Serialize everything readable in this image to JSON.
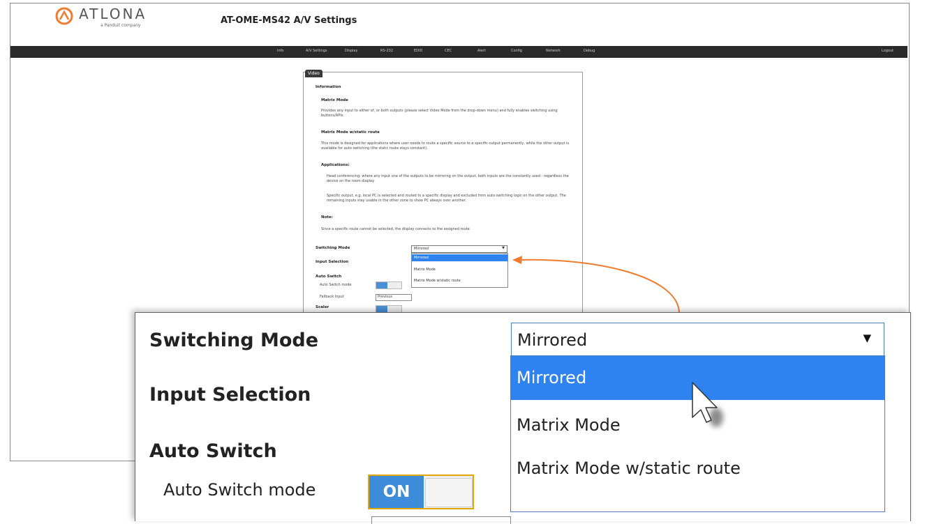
{
  "header": {
    "logo_text": "ATLONA",
    "logo_sub": "a Panduit company",
    "title": "AT-OME-MS42  A/V Settings"
  },
  "nav": {
    "items": [
      "Info",
      "A/V Settings",
      "Display",
      "RS-232",
      "EDID",
      "CEC",
      "Alert",
      "Config",
      "Network",
      "Debug"
    ],
    "logout": "Logout"
  },
  "panel": {
    "tab": "Video",
    "information": "Information",
    "matrix_mode": "Matrix Mode",
    "matrix_text": "Provides any input to either of, or both outputs (please select Video Mode from the drop-down menu) and fully enables switching using buttons/APIs.",
    "static_route": "Matrix Mode w/static route",
    "static_text": "This mode is designed for applications where user needs to route a specific source to a specific output permanently, while the other output is available for auto switching (the static route stays constant).",
    "applications": "Applications:",
    "app1": "Head conferencing: where any input one of the outputs to be mirroring on the output, both inputs are the constantly used - regardless the device on the room display.",
    "app2": "Specific output, e.g. local PC is selected and routed to a specific display and excluded from auto switching logic on the other output. The remaining inputs stay usable in the other zone to show PC always over another.",
    "note_label": "Note:",
    "note_text": "Since a specific route cannot be selected, the display connects to the assigned route.",
    "switching_mode": "Switching Mode",
    "input_selection": "Input Selection",
    "auto_switch": "Auto Switch",
    "auto_switch_mode": "Auto Switch mode",
    "fallback": "Fallback Input",
    "fallback_value": "Previous",
    "scaler": "Scaler",
    "select_value": "Mirrored",
    "options": [
      "Mirrored",
      "Matrix Mode",
      "Matrix Mode w/static route"
    ]
  },
  "zoom": {
    "switching_mode": "Switching Mode",
    "input_selection": "Input Selection",
    "auto_switch": "Auto Switch",
    "auto_switch_mode": "Auto Switch mode",
    "select_value": "Mirrored",
    "options": [
      "Mirrored",
      "Matrix Mode",
      "Matrix Mode w/static route"
    ],
    "toggle_on": "ON"
  },
  "colors": {
    "accent_blue": "#2f83f0",
    "annotation_orange": "#f07b2e",
    "nav_bg": "#2a2a2a"
  }
}
